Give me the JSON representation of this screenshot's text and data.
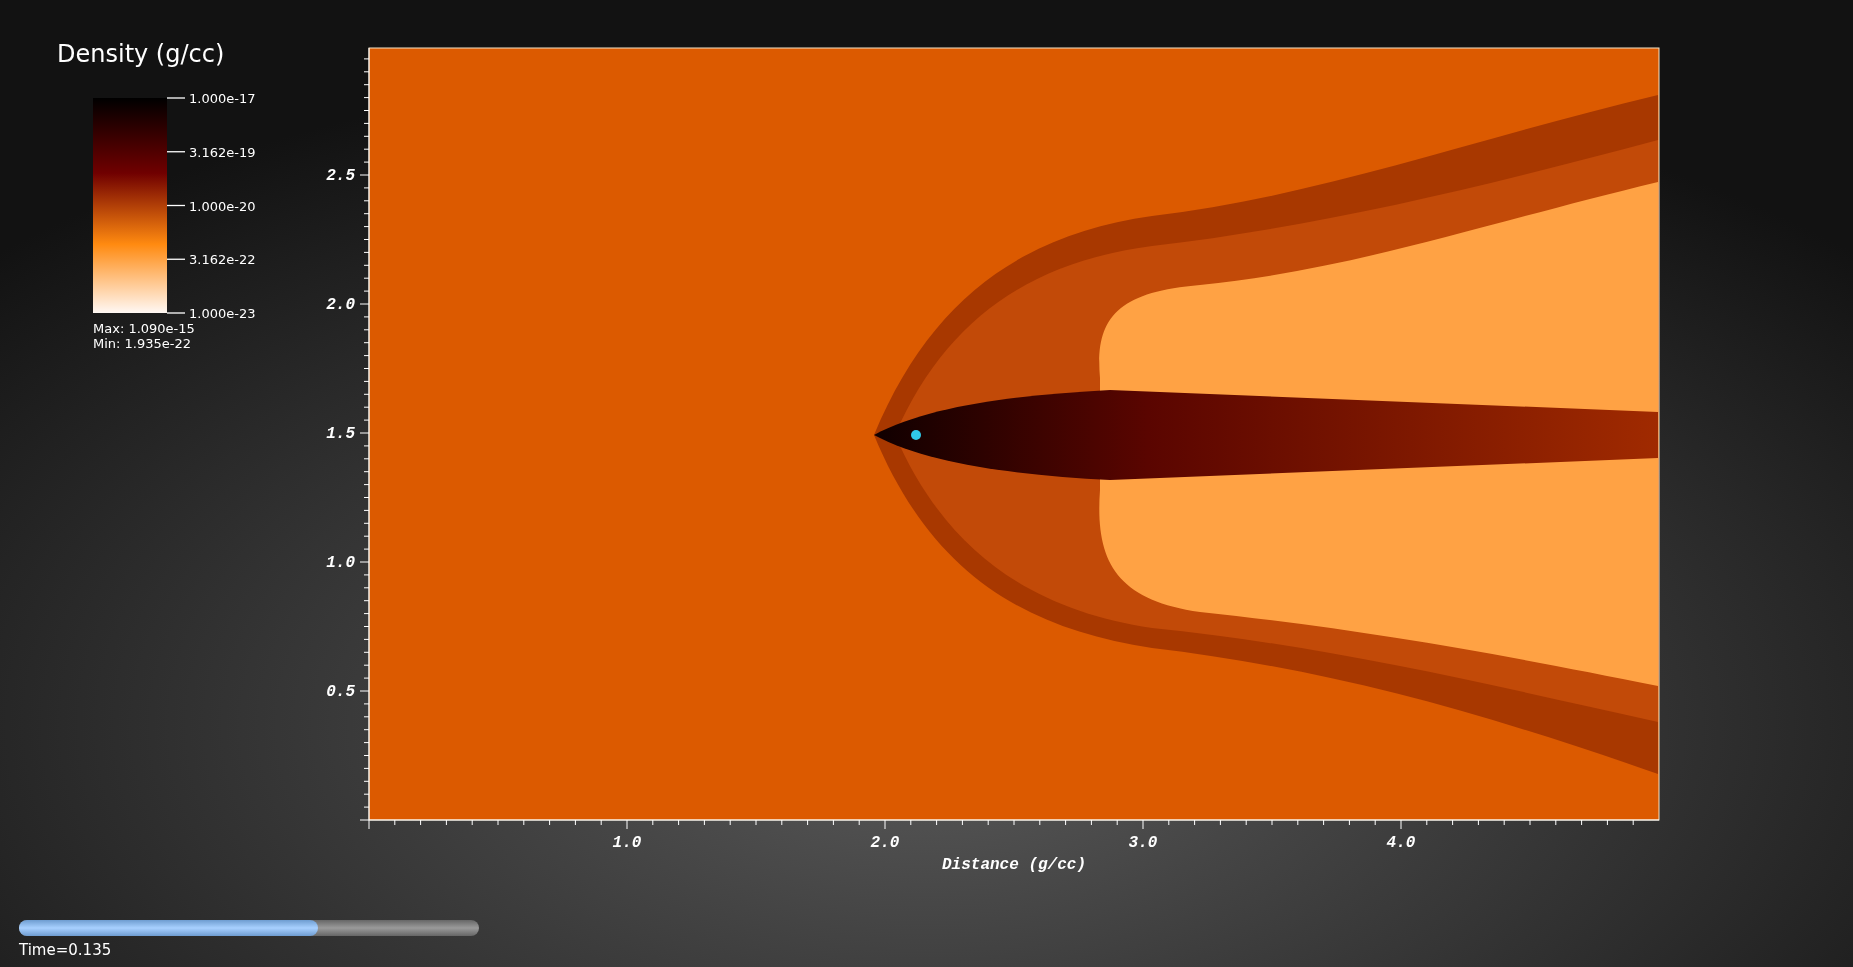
{
  "legend": {
    "title": "Density (g/cc)",
    "labels": [
      "1.000e-17",
      "3.162e-19",
      "1.000e-20",
      "3.162e-22",
      "1.000e-23"
    ],
    "max": "Max:  1.090e-15",
    "min": "Min:  1.935e-22"
  },
  "plot": {
    "xlabel": "Distance (g/cc)",
    "xticks": [
      "1.0",
      "2.0",
      "3.0",
      "4.0"
    ],
    "yticks": [
      "2.5",
      "2.0",
      "1.5",
      "1.0",
      "0.5"
    ]
  },
  "time_slider": {
    "level": 0.65,
    "label": "Time=0.135"
  }
}
